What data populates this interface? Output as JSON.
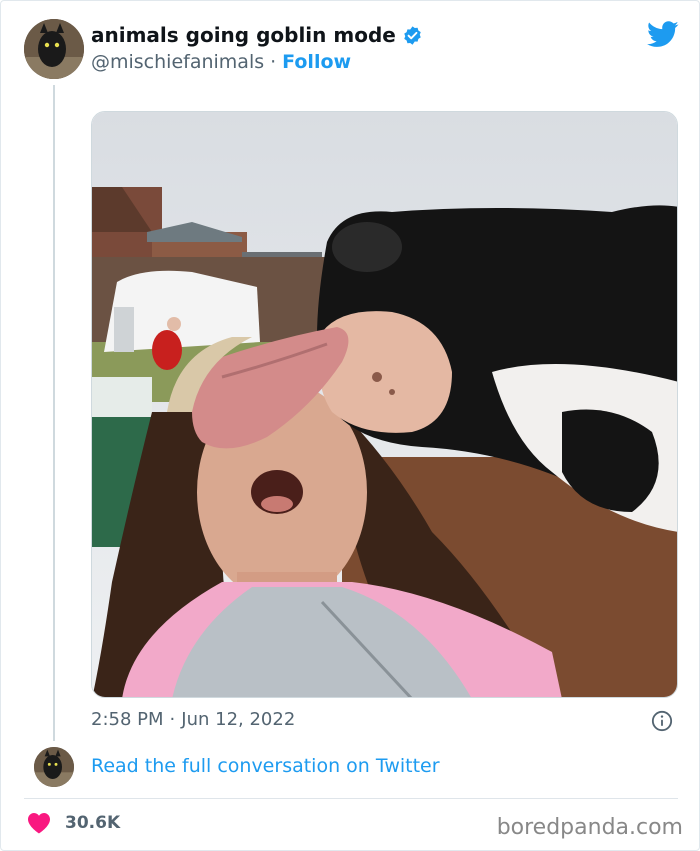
{
  "tweet": {
    "author_name": "animals going goblin mode",
    "author_handle": "@mischiefanimals",
    "separator": "·",
    "follow_label": "Follow",
    "time": "2:58 PM",
    "date": "Jun 12, 2022",
    "read_more": "Read the full conversation on Twitter",
    "likes": "30.6K"
  },
  "watermark": "boredpanda.com",
  "colors": {
    "twitter_blue": "#1d9bf0",
    "like_red": "#f91880",
    "muted_text": "#536471"
  },
  "icons": {
    "brand": "twitter-bird-icon",
    "verified": "verified-badge-icon",
    "info": "info-icon",
    "like": "heart-icon"
  }
}
